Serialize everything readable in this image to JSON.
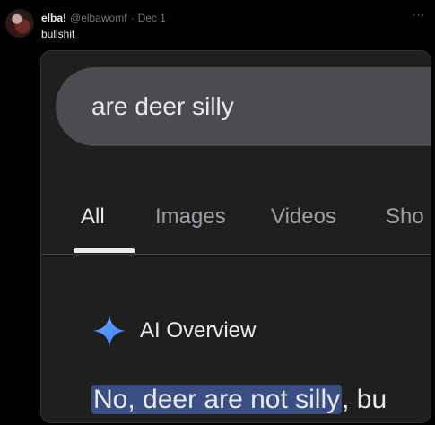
{
  "post": {
    "display_name": "elba!",
    "handle": "@elbawomf",
    "separator": "·",
    "date": "Dec 1",
    "more_icon": "more-horizontal-icon",
    "text": "bullshit"
  },
  "screenshot": {
    "search_query": "are deer silly",
    "tabs": [
      {
        "label": "All",
        "active": true
      },
      {
        "label": "Images",
        "active": false
      },
      {
        "label": "Videos",
        "active": false
      },
      {
        "label": "Sho",
        "active": false
      }
    ],
    "ai_overview": {
      "icon": "sparkle-icon",
      "label": "AI Overview"
    },
    "answer": {
      "highlighted": "No, deer are not silly",
      "rest": ", bu"
    }
  },
  "colors": {
    "background": "#000000",
    "media_background": "#1f1f1f",
    "search_box": "#4a4c50",
    "highlight": "#394f84",
    "sparkle": "#4f8ff7"
  }
}
